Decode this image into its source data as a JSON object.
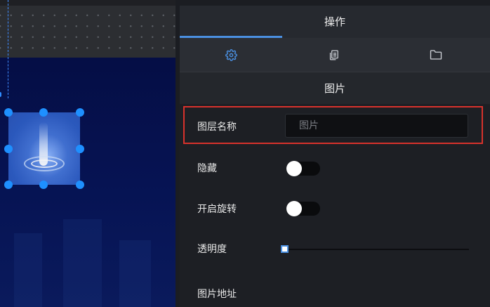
{
  "panel": {
    "title": "操作",
    "tabs": [
      {
        "icon": "gear-icon",
        "active": true
      },
      {
        "icon": "copy-pages-icon",
        "active": false
      },
      {
        "icon": "folder-icon",
        "active": false
      }
    ],
    "section_title": "图片",
    "fields": {
      "layer_name": {
        "label": "图层名称",
        "placeholder": "图片",
        "value": ""
      },
      "hidden": {
        "label": "隐藏",
        "on": false
      },
      "rotate": {
        "label": "开启旋转",
        "on": false
      },
      "opacity": {
        "label": "透明度",
        "value": 0
      },
      "image_url": {
        "label": "图片地址"
      }
    }
  },
  "colors": {
    "accent": "#4a8fe0",
    "handle": "#1e90ff",
    "highlight": "#d8322c",
    "stage": "#061353"
  }
}
